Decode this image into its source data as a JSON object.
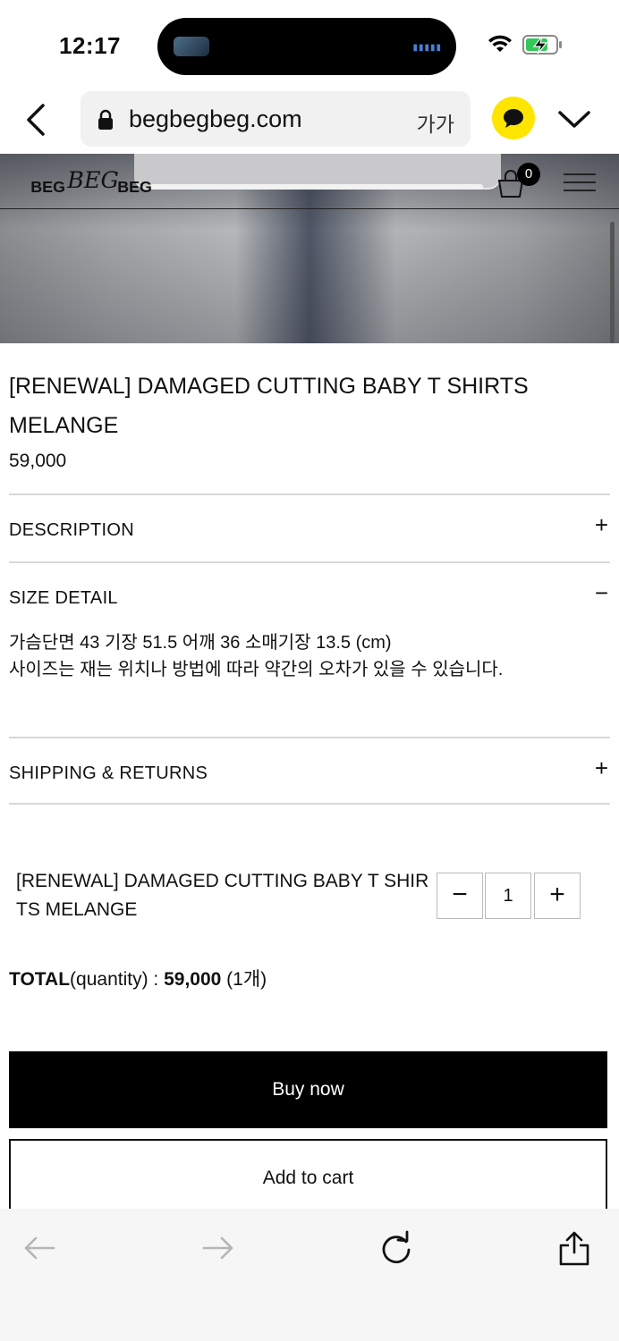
{
  "status_bar": {
    "time": "12:17"
  },
  "browser": {
    "url": "begbegbeg.com",
    "text_size_label": "가가"
  },
  "site": {
    "brand": "BEG BEG BEG",
    "cart_count": "0"
  },
  "product": {
    "title": "[RENEWAL] DAMAGED CUTTING BABY T SHIRTS MELANGE",
    "price": "59,000"
  },
  "sections": {
    "description": {
      "label": "DESCRIPTION",
      "toggle": "+"
    },
    "size_detail": {
      "label": "SIZE DETAIL",
      "toggle": "−",
      "line1": "가슴단면 43 기장 51.5 어깨 36 소매기장 13.5 (cm)",
      "line2": "사이즈는 재는 위치나 방법에 따라 약간의 오차가 있을 수 있습니다."
    },
    "shipping": {
      "label": "SHIPPING & RETURNS",
      "toggle": "+"
    }
  },
  "order": {
    "item_name": "[RENEWAL] DAMAGED CUTTING BABY T SHIRTS MELANGE",
    "quantity": "1",
    "minus": "−",
    "plus": "+",
    "total_label": "TOTAL",
    "total_qty_label": "(quantity) : ",
    "total_value": "59,000",
    "total_count": " (1개)"
  },
  "buttons": {
    "buy_now": "Buy now",
    "add_to_cart": "Add to cart"
  },
  "colors": {
    "kakao": "#fee500",
    "primary": "#000000",
    "ios_blue": "#007aff"
  },
  "icons": [
    "back-chevron-icon",
    "lock-icon",
    "kakao-chat-icon",
    "chevron-down-icon",
    "cart-icon",
    "menu-icon",
    "toolbar-back-icon",
    "toolbar-forward-icon",
    "reload-icon",
    "share-icon"
  ]
}
